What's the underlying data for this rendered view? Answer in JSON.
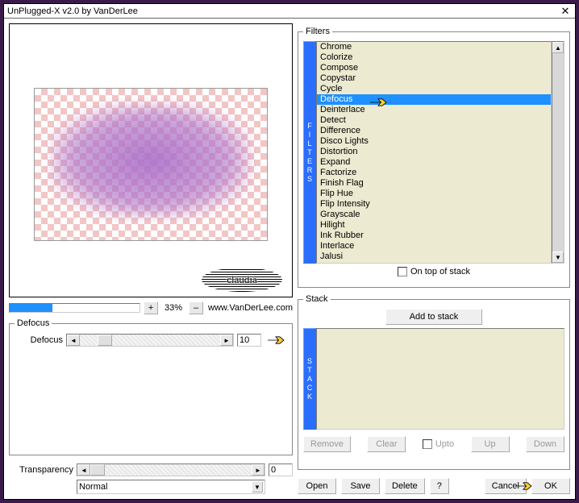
{
  "window": {
    "title": "UnPlugged-X v2.0 by VanDerLee"
  },
  "brand": "claudia",
  "zoom": {
    "percent_fill": 33,
    "label": "33%",
    "plus": "+",
    "minus": "–",
    "site": "www.VanDerLee.com"
  },
  "defocus": {
    "group": "Defocus",
    "label": "Defocus",
    "value": "10"
  },
  "transparency": {
    "label": "Transparency",
    "value": "0",
    "mode": "Normal"
  },
  "filters": {
    "group": "Filters",
    "vtab": "FILTERS",
    "items": [
      "Chrome",
      "Colorize",
      "Compose",
      "Copystar",
      "Cycle",
      "Defocus",
      "Deinterlace",
      "Detect",
      "Difference",
      "Disco Lights",
      "Distortion",
      "Expand",
      "Factorize",
      "Finish Flag",
      "Flip Hue",
      "Flip Intensity",
      "Grayscale",
      "Hilight",
      "Ink Rubber",
      "Interlace",
      "Jalusi"
    ],
    "selected_index": 5,
    "ontop": "On top of stack"
  },
  "stack": {
    "group": "Stack",
    "vtab": "STACK",
    "add": "Add to stack",
    "remove": "Remove",
    "clear": "Clear",
    "upto": "Upto",
    "up": "Up",
    "down": "Down"
  },
  "buttons": {
    "open": "Open",
    "save": "Save",
    "delete": "Delete",
    "help": "?",
    "cancel": "Cancel",
    "ok": "OK"
  }
}
